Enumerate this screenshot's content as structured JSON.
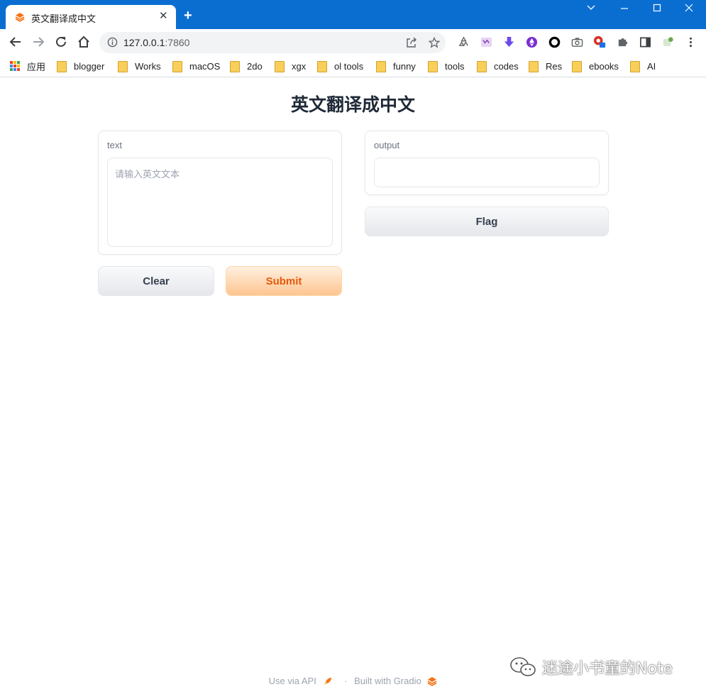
{
  "browser": {
    "tab_title": "英文翻译成中文",
    "url_host": "127.0.0.1",
    "url_port": ":7860",
    "bookmarks": [
      {
        "label": "应用"
      },
      {
        "label": "blogger"
      },
      {
        "label": "Works"
      },
      {
        "label": "macOS"
      },
      {
        "label": "2do"
      },
      {
        "label": "xgx"
      },
      {
        "label": "ol tools"
      },
      {
        "label": "funny"
      },
      {
        "label": "tools"
      },
      {
        "label": "codes"
      },
      {
        "label": "Res"
      },
      {
        "label": "ebooks"
      },
      {
        "label": "AI"
      }
    ]
  },
  "page": {
    "title": "英文翻译成中文",
    "input": {
      "label": "text",
      "placeholder": "请输入英文文本",
      "value": ""
    },
    "output": {
      "label": "output",
      "value": ""
    },
    "buttons": {
      "clear": "Clear",
      "submit": "Submit",
      "flag": "Flag"
    },
    "footer": {
      "api": "Use via API",
      "separator": "·",
      "built": "Built with Gradio"
    },
    "watermark": "迷途小书童的Note"
  },
  "colors": {
    "titlebar": "#0a6ed1",
    "submit_text": "#ea580c",
    "submit_bg": "#fdc58f"
  }
}
